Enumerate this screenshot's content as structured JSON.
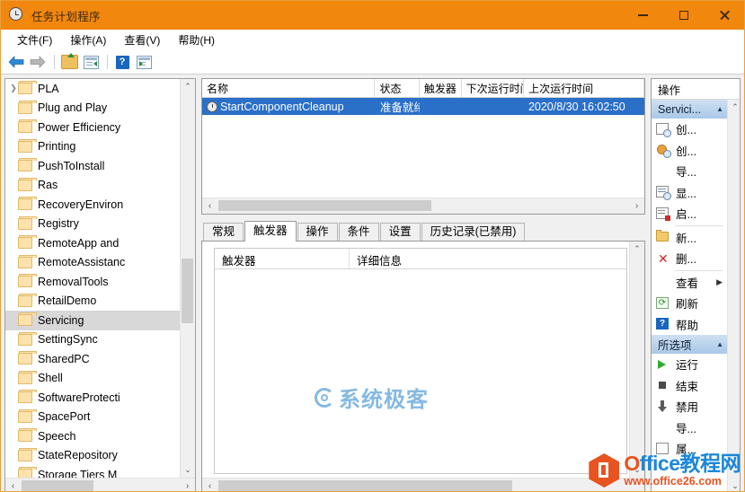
{
  "window": {
    "title": "任务计划程序",
    "icon": "clock-icon",
    "accent_color": "#f2870d",
    "controls": {
      "minimize": "–",
      "maximize": "□",
      "close": "✕"
    }
  },
  "menubar": {
    "items": [
      {
        "label": "文件(F)",
        "name": "menu-file"
      },
      {
        "label": "操作(A)",
        "name": "menu-action"
      },
      {
        "label": "查看(V)",
        "name": "menu-view"
      },
      {
        "label": "帮助(H)",
        "name": "menu-help"
      }
    ]
  },
  "toolbar": {
    "items": [
      {
        "name": "back-icon",
        "glyph": "◀"
      },
      {
        "name": "forward-icon",
        "glyph": "▶"
      },
      {
        "name": "up-folder-icon",
        "glyph": ""
      },
      {
        "name": "show-pane-icon",
        "glyph": ""
      },
      {
        "name": "help-icon",
        "glyph": "?"
      },
      {
        "name": "show-action-pane-icon",
        "glyph": ""
      }
    ]
  },
  "tree": {
    "selected": "Servicing",
    "items": [
      {
        "label": "PLA",
        "expandable": true
      },
      {
        "label": "Plug and Play",
        "expandable": false
      },
      {
        "label": "Power Efficiency",
        "expandable": false
      },
      {
        "label": "Printing",
        "expandable": false
      },
      {
        "label": "PushToInstall",
        "expandable": false
      },
      {
        "label": "Ras",
        "expandable": false
      },
      {
        "label": "RecoveryEnviron",
        "expandable": false
      },
      {
        "label": "Registry",
        "expandable": false
      },
      {
        "label": "RemoteApp and",
        "expandable": false
      },
      {
        "label": "RemoteAssistanc",
        "expandable": false
      },
      {
        "label": "RemovalTools",
        "expandable": false
      },
      {
        "label": "RetailDemo",
        "expandable": false
      },
      {
        "label": "Servicing",
        "expandable": false
      },
      {
        "label": "SettingSync",
        "expandable": false
      },
      {
        "label": "SharedPC",
        "expandable": false
      },
      {
        "label": "Shell",
        "expandable": false
      },
      {
        "label": "SoftwareProtecti",
        "expandable": false
      },
      {
        "label": "SpacePort",
        "expandable": false
      },
      {
        "label": "Speech",
        "expandable": false
      },
      {
        "label": "StateRepository",
        "expandable": false
      },
      {
        "label": "Storage Tiers M",
        "expandable": false
      }
    ]
  },
  "tasklist": {
    "columns": [
      "名称",
      "状态",
      "触发器",
      "下次运行时间",
      "上次运行时间"
    ],
    "rows": [
      {
        "name": "StartComponentCleanup",
        "status": "准备就绪",
        "trigger": "",
        "next_run": "",
        "last_run": "2020/8/30 16:02:50",
        "selected": true
      }
    ]
  },
  "tabs": {
    "active": "触发器",
    "items": [
      "常规",
      "触发器",
      "操作",
      "条件",
      "设置",
      "历史记录(已禁用)"
    ]
  },
  "detail": {
    "columns": [
      "触发器",
      "详细信息"
    ],
    "rows": []
  },
  "actions": {
    "title": "操作",
    "groups": [
      {
        "header": "Servici...",
        "collapse_glyph": "▲",
        "items": [
          {
            "label": "创...",
            "icon": "create-task-icon",
            "separator_after": false
          },
          {
            "label": "创...",
            "icon": "create-basic-task-icon",
            "separator_after": false
          },
          {
            "label": "导...",
            "icon": "none",
            "separator_after": false
          },
          {
            "label": "显...",
            "icon": "display-all-running-icon",
            "separator_after": false
          },
          {
            "label": "启...",
            "icon": "enable-history-icon",
            "separator_after": true
          },
          {
            "label": "新...",
            "icon": "new-folder-icon",
            "separator_after": false
          },
          {
            "label": "删...",
            "icon": "delete-folder-icon",
            "separator_after": true
          },
          {
            "label": "查看",
            "icon": "none",
            "submenu": "▶",
            "separator_after": false
          },
          {
            "label": "刷新",
            "icon": "refresh-icon",
            "separator_after": false
          },
          {
            "label": "帮助",
            "icon": "help-icon",
            "separator_after": false
          }
        ]
      },
      {
        "header": "所选项",
        "collapse_glyph": "▲",
        "items": [
          {
            "label": "运行",
            "icon": "run-icon",
            "separator_after": false
          },
          {
            "label": "结束",
            "icon": "end-icon",
            "separator_after": false
          },
          {
            "label": "禁用",
            "icon": "disable-icon",
            "separator_after": false
          },
          {
            "label": "导...",
            "icon": "none",
            "separator_after": false
          },
          {
            "label": "属...",
            "icon": "properties-icon",
            "separator_after": false
          }
        ]
      }
    ]
  },
  "watermarks": {
    "center": {
      "text": "系统极客",
      "color": "#7fb6e0"
    },
    "bottom_right": {
      "brand_prefix": "O",
      "brand": "ffice教程网",
      "url": "www.office26.com",
      "colors": {
        "blue": "#1b87d8",
        "orange": "#e8531f"
      }
    }
  }
}
